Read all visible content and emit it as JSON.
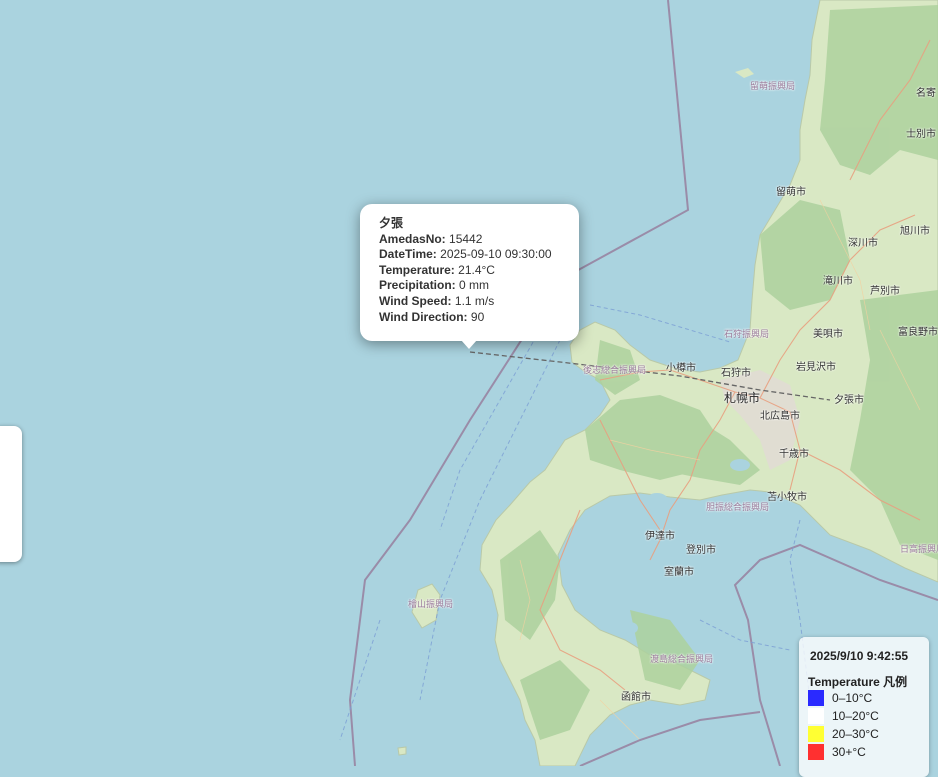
{
  "popup": {
    "station": "夕張",
    "rows": [
      {
        "label": "AmedasNo:",
        "value": "15442"
      },
      {
        "label": "DateTime:",
        "value": "2025-09-10 09:30:00"
      },
      {
        "label": "Temperature:",
        "value": "21.4°C"
      },
      {
        "label": "Precipitation:",
        "value": "0 mm"
      },
      {
        "label": "Wind Speed:",
        "value": "1.1 m/s"
      },
      {
        "label": "Wind Direction:",
        "value": "90"
      }
    ]
  },
  "legend": {
    "timestamp": "2025/9/10 9:42:55",
    "title": "Temperature 凡例",
    "items": [
      {
        "label": "0–10°C",
        "color": "#2a2aff"
      },
      {
        "label": "10–20°C",
        "color": "#ffffff"
      },
      {
        "label": "20–30°C",
        "color": "#ffff33"
      },
      {
        "label": "30+°C",
        "color": "#ff3030"
      }
    ]
  },
  "places": {
    "rumoi_sub": "留萌振興局",
    "nayoro": "名寄",
    "shibetsu": "士別市",
    "rumoi": "留萌市",
    "asahikawa": "旭川市",
    "fukagawa": "深川市",
    "takikawa": "滝川市",
    "ashibetsu": "芦別市",
    "furano": "富良野市",
    "bibai": "美唄市",
    "ishikari_sub": "石狩振興局",
    "otaru": "小樽市",
    "ishikari": "石狩市",
    "iwamizawa": "岩見沢市",
    "shiribeshi_sub": "後志総合振興局",
    "sapporo": "札幌市",
    "yubari": "夕張市",
    "kitahiroshima": "北広島市",
    "chitose": "千歳市",
    "tomakomai": "苫小牧市",
    "iburi_sub": "胆振総合振興局",
    "date": "伊達市",
    "noboribetsu": "登別市",
    "muroran": "室蘭市",
    "hidaka_sub": "日高振興局",
    "hiyama_sub": "檜山振興局",
    "oshima_sub": "渡島総合振興局",
    "hakodate": "函館市"
  },
  "colors": {
    "sea": "#aad3df",
    "land": "#d9e8c4",
    "forest": "#add19e",
    "urban": "#e0dcd4",
    "border": "#9a8ca8"
  }
}
